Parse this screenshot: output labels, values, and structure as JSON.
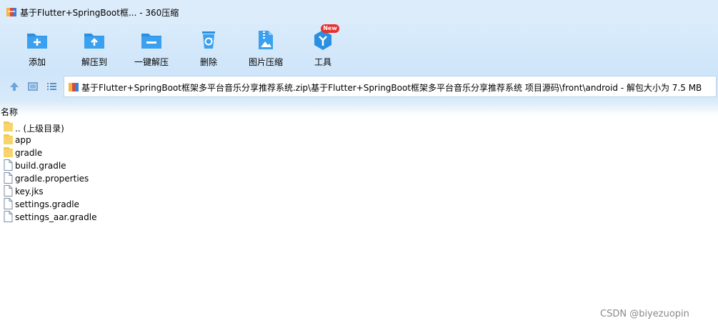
{
  "window": {
    "title": "基于Flutter+SpringBoot框... - 360压缩"
  },
  "toolbar": {
    "buttons": [
      {
        "label": "添加",
        "icon": "add-folder-icon"
      },
      {
        "label": "解压到",
        "icon": "extract-to-icon"
      },
      {
        "label": "一键解压",
        "icon": "one-click-extract-icon"
      },
      {
        "label": "删除",
        "icon": "recycle-bin-icon"
      },
      {
        "label": "图片压缩",
        "icon": "image-compress-icon"
      },
      {
        "label": "工具",
        "icon": "tools-icon",
        "badge": "New"
      }
    ]
  },
  "address": {
    "path": "基于Flutter+SpringBoot框架多平台音乐分享推荐系统.zip\\基于Flutter+SpringBoot框架多平台音乐分享推荐系统 项目源码\\front\\android - 解包大小为 7.5 MB"
  },
  "list": {
    "column_name": "名称",
    "items": [
      {
        "name": ".. (上级目录)",
        "type": "folder"
      },
      {
        "name": "app",
        "type": "folder"
      },
      {
        "name": "gradle",
        "type": "folder"
      },
      {
        "name": "build.gradle",
        "type": "file"
      },
      {
        "name": "gradle.properties",
        "type": "file"
      },
      {
        "name": "key.jks",
        "type": "file"
      },
      {
        "name": "settings.gradle",
        "type": "file"
      },
      {
        "name": "settings_aar.gradle",
        "type": "file"
      }
    ]
  },
  "watermark": "CSDN @biyezuopin",
  "colors": {
    "accent": "#2b8fe0",
    "badge": "#e8302c",
    "folder": "#f5c84c"
  }
}
